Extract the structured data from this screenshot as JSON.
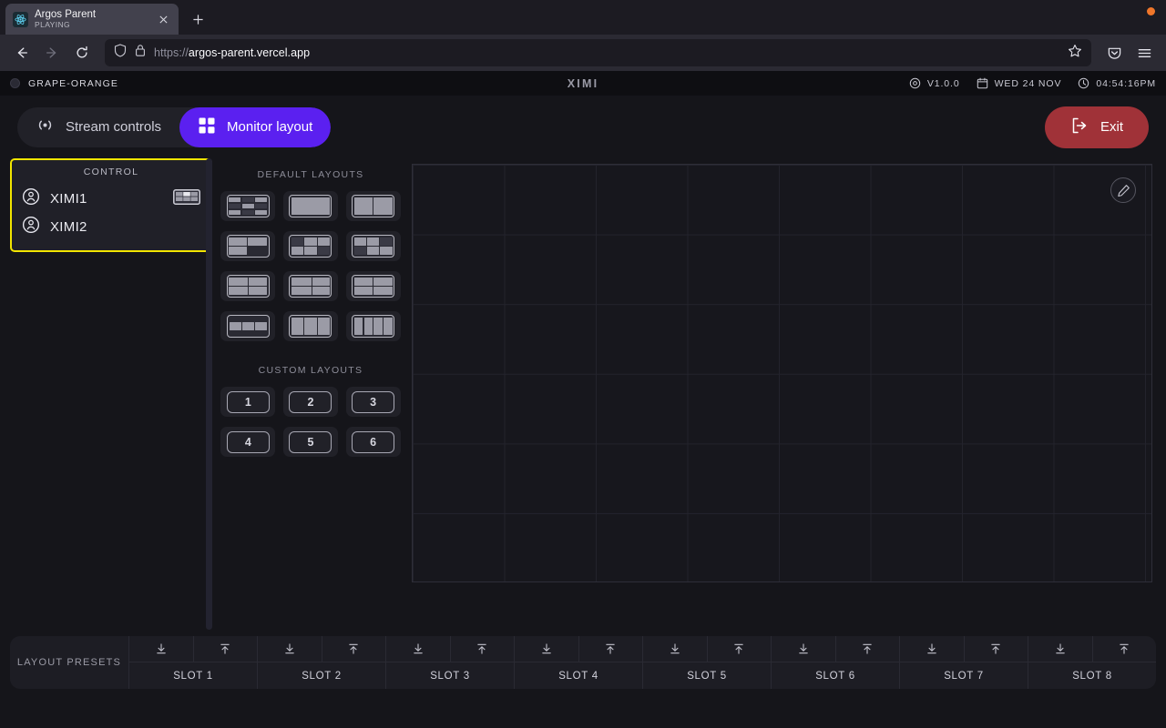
{
  "browser": {
    "tab": {
      "title": "Argos Parent",
      "status": "PLAYING",
      "favicon": "react-icon"
    },
    "url_scheme": "https://",
    "url_host": "argos-parent.vercel.app",
    "icons": {
      "back": "back-arrow-icon",
      "forward": "forward-arrow-icon",
      "reload": "reload-icon",
      "shield": "shield-icon",
      "lock": "lock-icon",
      "bookmark": "star-icon",
      "pocket": "pocket-icon",
      "menu": "hamburger-menu-icon",
      "newtab": "plus-icon",
      "close": "close-icon"
    }
  },
  "header": {
    "device_name": "GRAPE-ORANGE",
    "logo": "XIMI",
    "version": "V1.0.0",
    "date": "WED 24 NOV",
    "time": "04:54:16PM"
  },
  "nav": {
    "tabs": [
      {
        "label": "Stream controls",
        "icon": "broadcast-icon",
        "active": false
      },
      {
        "label": "Monitor layout",
        "icon": "grid-icon",
        "active": true
      }
    ],
    "exit_label": "Exit",
    "accent": "#5b20f0",
    "exit_color": "#a03238"
  },
  "control_panel": {
    "title": "CONTROL",
    "border_color": "#f2e500",
    "items": [
      {
        "name": "XIMI1",
        "icon": "person-circle-icon",
        "has_layout_thumb": true
      },
      {
        "name": "XIMI2",
        "icon": "person-circle-icon",
        "has_layout_thumb": false
      }
    ]
  },
  "default_layouts": {
    "title": "DEFAULT LAYOUTS",
    "items": [
      {
        "id": 1,
        "cols": 3,
        "rows": 3
      },
      {
        "id": 2,
        "cols": 1,
        "rows": 1
      },
      {
        "id": 3,
        "cols": 2,
        "rows": 1
      },
      {
        "id": 4,
        "cols": 2,
        "rows": 2
      },
      {
        "id": 5,
        "cols": 3,
        "rows": 2
      },
      {
        "id": 6,
        "cols": 3,
        "rows": 2
      },
      {
        "id": 7,
        "cols": 2,
        "rows": 2
      },
      {
        "id": 8,
        "cols": 2,
        "rows": 2
      },
      {
        "id": 9,
        "cols": 2,
        "rows": 2
      },
      {
        "id": 10,
        "cols": 3,
        "rows": 1
      },
      {
        "id": 11,
        "cols": 3,
        "rows": 1
      },
      {
        "id": 12,
        "cols": 4,
        "rows": 1
      }
    ]
  },
  "custom_layouts": {
    "title": "CUSTOM LAYOUTS",
    "items": [
      "1",
      "2",
      "3",
      "4",
      "5",
      "6"
    ]
  },
  "canvas": {
    "edit_icon": "pencil-icon",
    "grid_cols": 8,
    "grid_rows": 6
  },
  "presets": {
    "label": "LAYOUT PRESETS",
    "save_icon": "download-icon",
    "load_icon": "upload-icon",
    "slots": [
      "SLOT 1",
      "SLOT 2",
      "SLOT 3",
      "SLOT 4",
      "SLOT 5",
      "SLOT 6",
      "SLOT 7",
      "SLOT 8"
    ]
  }
}
